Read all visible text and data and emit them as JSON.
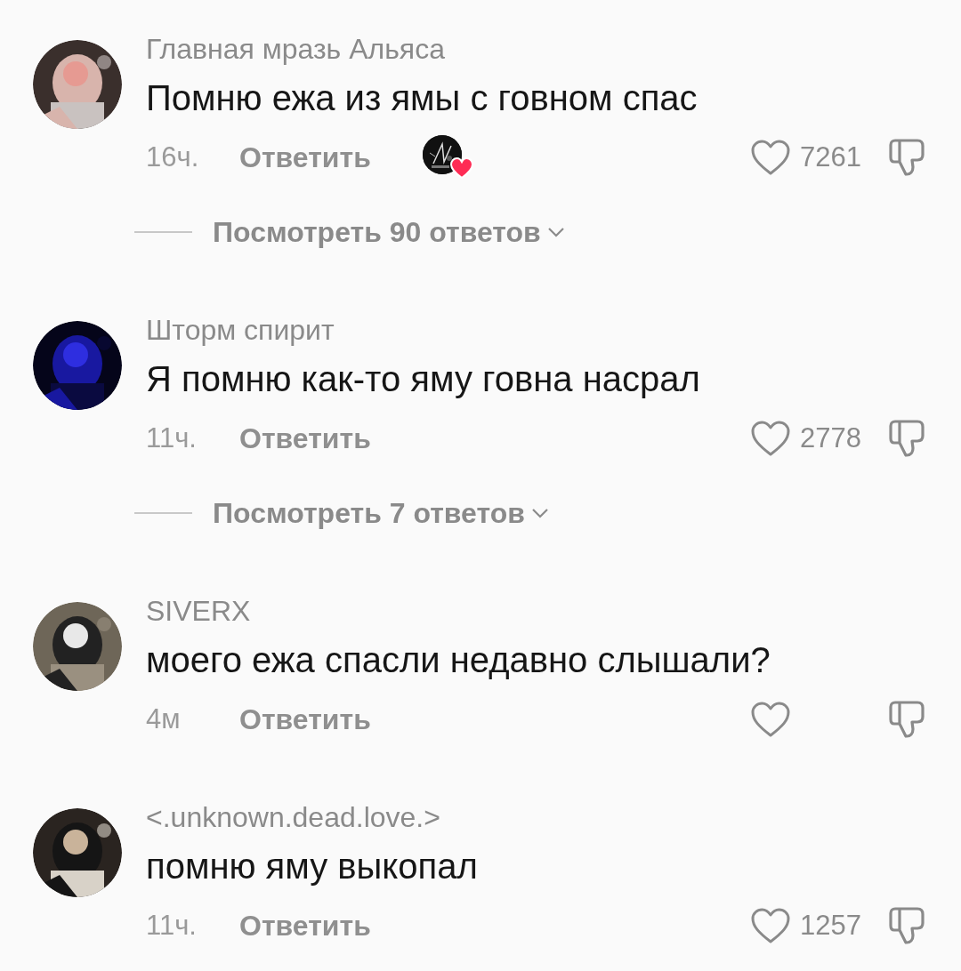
{
  "comments": [
    {
      "author": "Главная мразь Альяса",
      "text": "Помню ежа из ямы с говном спас",
      "time": "16ч.",
      "reply": "Ответить",
      "creator_liked": true,
      "likes": "7261",
      "view_replies": "Посмотреть 90 ответов"
    },
    {
      "author": "Шторм спирит",
      "text": "Я помню как-то яму говна насрал",
      "time": "11ч.",
      "reply": "Ответить",
      "creator_liked": false,
      "likes": "2778",
      "view_replies": "Посмотреть 7 ответов"
    },
    {
      "author": "SIVERX",
      "text": "моего ежа спасли недавно слышали?",
      "time": "4м",
      "reply": "Ответить",
      "creator_liked": false
    },
    {
      "author": "<.unknown.dead.love.>",
      "text": "помню яму выкопал",
      "time": "11ч.",
      "reply": "Ответить",
      "creator_liked": false,
      "likes": "1257"
    }
  ]
}
